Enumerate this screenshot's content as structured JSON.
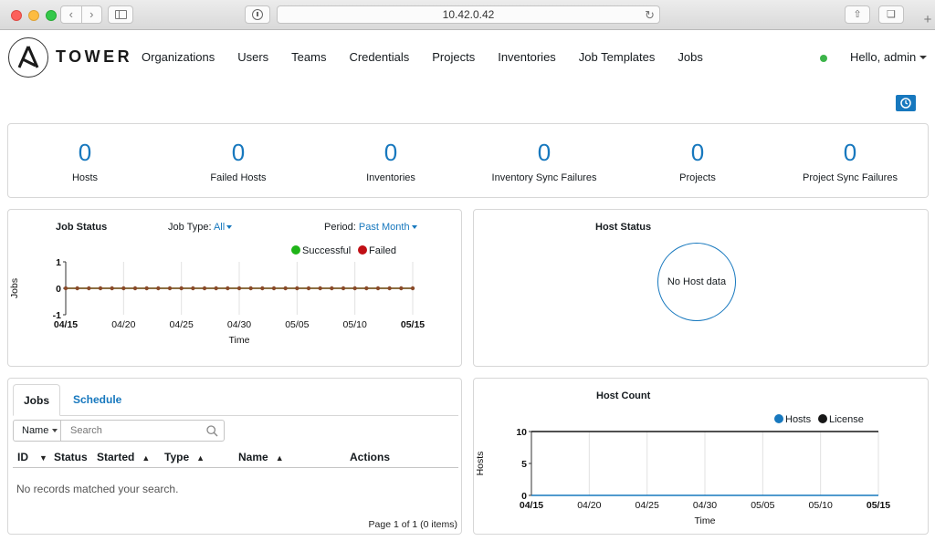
{
  "browser": {
    "url": "10.42.0.42"
  },
  "header": {
    "logo_text": "TOWER",
    "nav": [
      "Organizations",
      "Users",
      "Teams",
      "Credentials",
      "Projects",
      "Inventories",
      "Job Templates",
      "Jobs"
    ],
    "user_greeting": "Hello, admin",
    "status_color": "#3cb44a"
  },
  "counts": [
    {
      "value": "0",
      "label": "Hosts"
    },
    {
      "value": "0",
      "label": "Failed Hosts"
    },
    {
      "value": "0",
      "label": "Inventories"
    },
    {
      "value": "0",
      "label": "Inventory Sync Failures"
    },
    {
      "value": "0",
      "label": "Projects"
    },
    {
      "value": "0",
      "label": "Project Sync Failures"
    }
  ],
  "job_status": {
    "title": "Job Status",
    "job_type_label": "Job Type:",
    "job_type_value": "All",
    "period_label": "Period:",
    "period_value": "Past Month",
    "legend": [
      {
        "name": "Successful",
        "color": "#1fb418"
      },
      {
        "name": "Failed",
        "color": "#c00f15"
      }
    ]
  },
  "host_status": {
    "title": "Host Status",
    "empty_text": "No Host data"
  },
  "jobs_panel": {
    "tab_jobs": "Jobs",
    "tab_schedule": "Schedule",
    "filter_field": "Name",
    "search_placeholder": "Search",
    "columns": [
      "ID",
      "Status",
      "Started",
      "Type",
      "Name",
      "Actions"
    ],
    "empty_text": "No records matched your search.",
    "pagination": "Page 1 of 1 (0 items)"
  },
  "host_count": {
    "title": "Host Count"
  },
  "chart_data": [
    {
      "type": "line",
      "title": "Job Status",
      "xlabel": "Time",
      "ylabel": "Jobs",
      "ylim": [
        -1,
        1
      ],
      "yticks": [
        "1",
        "0",
        "-1"
      ],
      "xticks": [
        "04/15",
        "04/20",
        "04/25",
        "04/30",
        "05/05",
        "05/10",
        "05/15"
      ],
      "points_count": 31,
      "series": [
        {
          "name": "Successful",
          "color": "#1fb418",
          "value": 0
        },
        {
          "name": "Failed",
          "color": "#c00f15",
          "value": 0
        }
      ]
    },
    {
      "type": "line",
      "title": "Host Count",
      "xlabel": "Time",
      "ylabel": "Hosts",
      "ylim": [
        0,
        10
      ],
      "yticks": [
        "10",
        "5",
        "0"
      ],
      "xticks": [
        "04/15",
        "04/20",
        "04/25",
        "04/30",
        "05/05",
        "05/10",
        "05/15"
      ],
      "series": [
        {
          "name": "Hosts",
          "color": "#1778be",
          "value": 0
        },
        {
          "name": "License",
          "color": "#171717",
          "value": 10
        }
      ]
    }
  ]
}
